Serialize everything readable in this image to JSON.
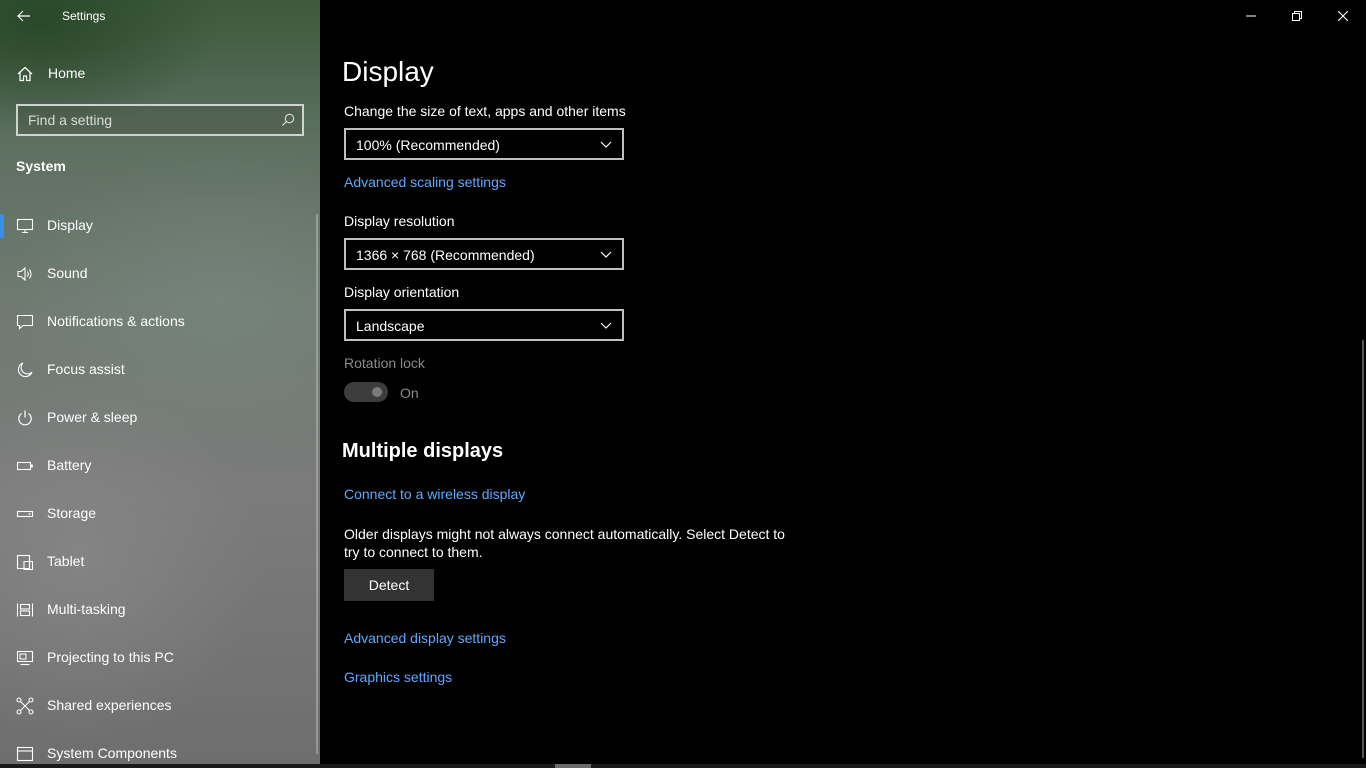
{
  "window": {
    "title": "Settings",
    "controls": [
      "minimize",
      "restore",
      "close"
    ]
  },
  "sidebar": {
    "home_label": "Home",
    "search_placeholder": "Find a setting",
    "section": "System",
    "active_item": "Display",
    "items": [
      {
        "label": "Display",
        "icon": "monitor-icon"
      },
      {
        "label": "Sound",
        "icon": "speaker-icon"
      },
      {
        "label": "Notifications & actions",
        "icon": "message-icon"
      },
      {
        "label": "Focus assist",
        "icon": "moon-icon"
      },
      {
        "label": "Power & sleep",
        "icon": "power-icon"
      },
      {
        "label": "Battery",
        "icon": "battery-icon"
      },
      {
        "label": "Storage",
        "icon": "storage-icon"
      },
      {
        "label": "Tablet",
        "icon": "tablet-icon"
      },
      {
        "label": "Multi-tasking",
        "icon": "multitasking-icon"
      },
      {
        "label": "Projecting to this PC",
        "icon": "projecting-icon"
      },
      {
        "label": "Shared experiences",
        "icon": "shared-icon"
      },
      {
        "label": "System Components",
        "icon": "components-icon"
      }
    ]
  },
  "main": {
    "title": "Display",
    "scale": {
      "label": "Change the size of text, apps and other items",
      "value": "100% (Recommended)",
      "advanced_link": "Advanced scaling settings"
    },
    "resolution": {
      "label": "Display resolution",
      "value": "1366 × 768 (Recommended)"
    },
    "orientation": {
      "label": "Display orientation",
      "value": "Landscape"
    },
    "rotation_lock": {
      "label": "Rotation lock",
      "state": "On",
      "enabled": false
    },
    "multiple_displays": {
      "heading": "Multiple displays",
      "wireless_link": "Connect to a wireless display",
      "description": "Older displays might not always connect automatically. Select Detect to try to connect to them.",
      "detect_button": "Detect",
      "advanced_display_link": "Advanced display settings",
      "graphics_link": "Graphics settings"
    }
  },
  "colors": {
    "accent": "#3a8ee6",
    "link": "#5ea9ff",
    "background": "#000000"
  }
}
